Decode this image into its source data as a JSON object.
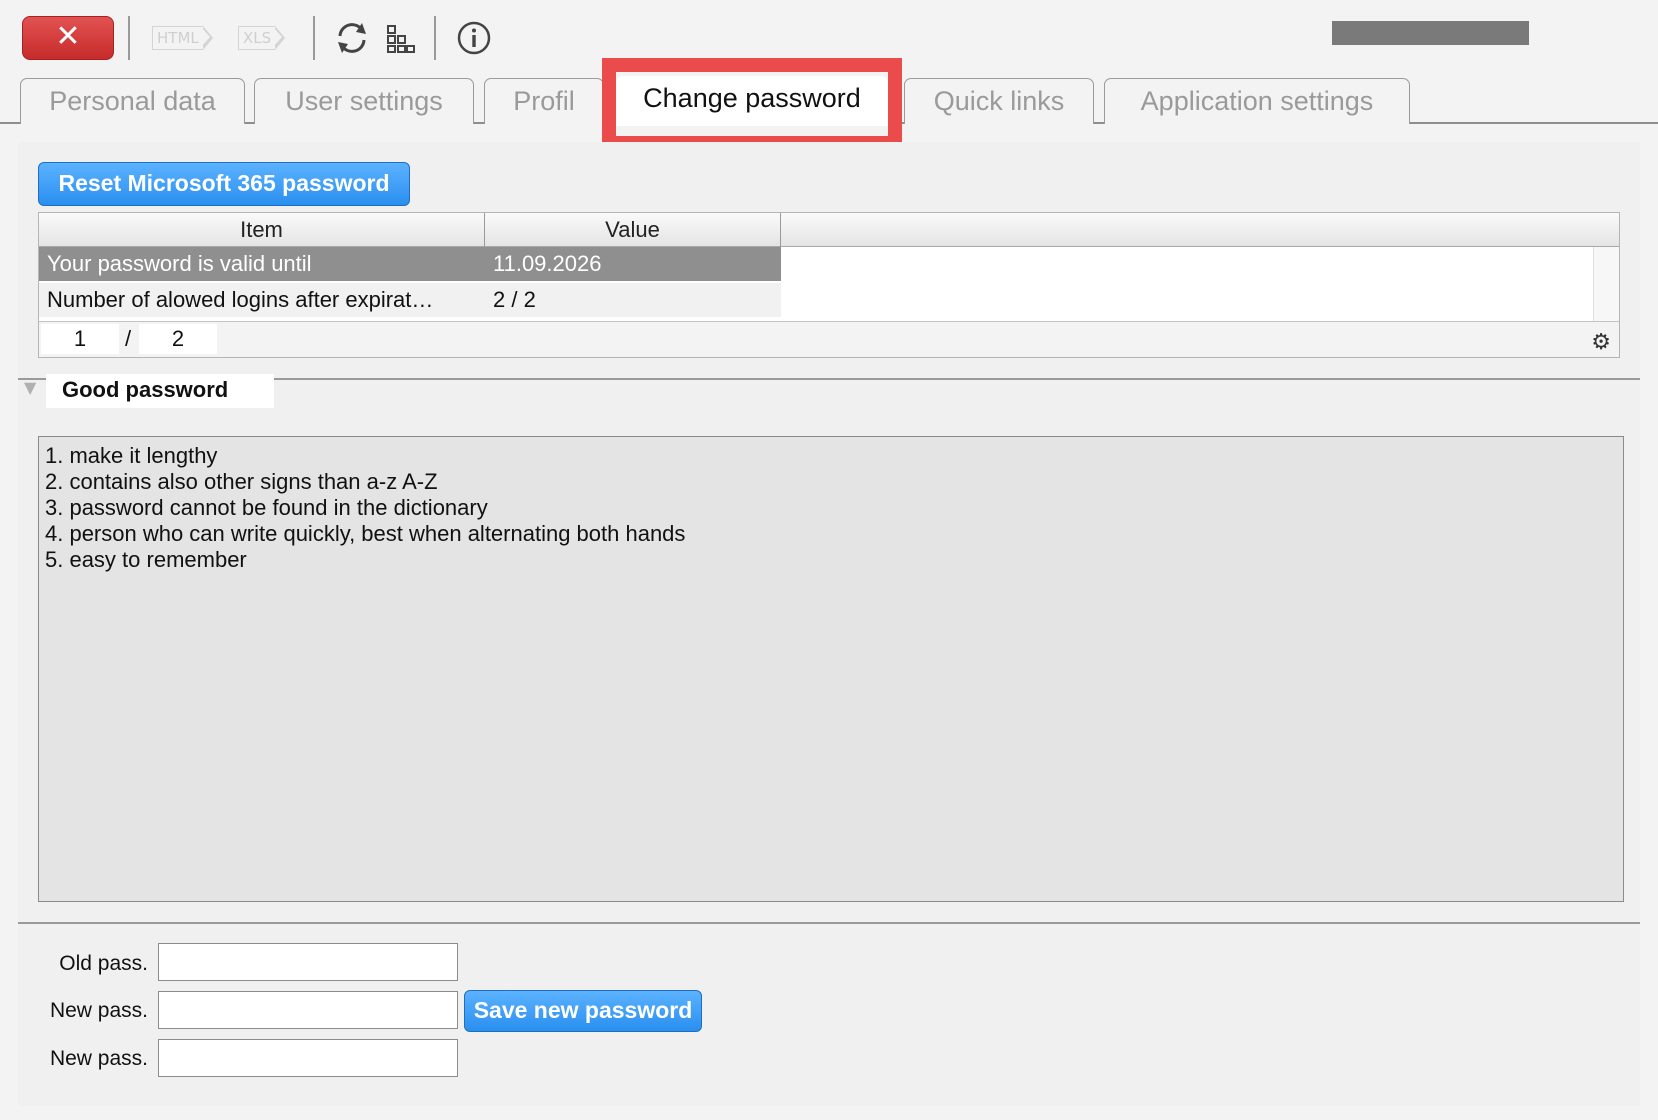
{
  "toolbar": {
    "close_label": "✕",
    "html_label": "HTML",
    "xls_label": "XLS",
    "icons": [
      "close-icon",
      "html-export-icon",
      "xls-export-icon",
      "refresh-icon",
      "hierarchy-icon",
      "info-icon"
    ]
  },
  "tabs": [
    {
      "label": "Personal data"
    },
    {
      "label": "User settings"
    },
    {
      "label": "Profil"
    },
    {
      "label": "Change password"
    },
    {
      "label": "Quick links"
    },
    {
      "label": "Application settings"
    }
  ],
  "reset_button": "Reset Microsoft 365 password",
  "table": {
    "headers": [
      "Item",
      "Value"
    ],
    "rows": [
      {
        "item": "Your password is valid until",
        "value": "11.09.2026"
      },
      {
        "item": "Number of alowed logins after expirat…",
        "value": "2 / 2"
      }
    ],
    "pager": {
      "current": "1",
      "separator": "/",
      "total": "2"
    }
  },
  "good_password": {
    "title": "Good password",
    "lines": [
      "1. make it lengthy",
      "2. contains also other signs than a-z A-Z",
      "3. password cannot be found in the dictionary",
      "4. person who can write quickly, best when alternating both hands",
      "5. easy to remember"
    ]
  },
  "form": {
    "old_label": "Old pass.",
    "new_label": "New pass.",
    "confirm_label": "New pass.",
    "old_value": "",
    "new_value": "",
    "confirm_value": "",
    "save_label": "Save new password"
  },
  "colors": {
    "accent_blue": "#2a8fef",
    "close_red": "#d83b3b",
    "highlight_red": "#ea4c4c",
    "selected_row": "#8f8f8f"
  }
}
